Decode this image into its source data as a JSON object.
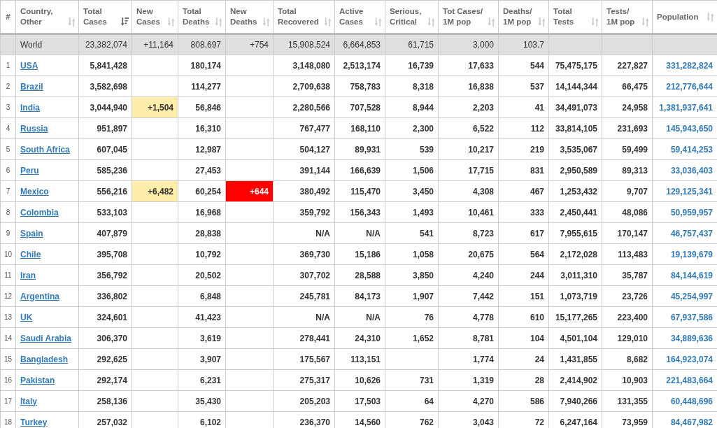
{
  "table": {
    "columns": [
      {
        "label": "#",
        "kind": "index"
      },
      {
        "label": "Country,\nOther",
        "kind": "sortable",
        "sorted": false
      },
      {
        "label": "Total\nCases",
        "kind": "sortable",
        "sorted": true
      },
      {
        "label": "New\nCases",
        "kind": "sortable",
        "sorted": false
      },
      {
        "label": "Total\nDeaths",
        "kind": "sortable",
        "sorted": false
      },
      {
        "label": "New\nDeaths",
        "kind": "sortable",
        "sorted": false
      },
      {
        "label": "Total\nRecovered",
        "kind": "sortable",
        "sorted": false
      },
      {
        "label": "Active\nCases",
        "kind": "sortable",
        "sorted": false
      },
      {
        "label": "Serious,\nCritical",
        "kind": "sortable",
        "sorted": false
      },
      {
        "label": "Tot Cases/\n1M pop",
        "kind": "sortable",
        "sorted": false
      },
      {
        "label": "Deaths/\n1M pop",
        "kind": "sortable",
        "sorted": false
      },
      {
        "label": "Total\nTests",
        "kind": "sortable",
        "sorted": false
      },
      {
        "label": "Tests/\n1M pop",
        "kind": "sortable",
        "sorted": false
      },
      {
        "label": "Population",
        "kind": "sortable",
        "sorted": false
      }
    ],
    "world_row": {
      "cells": [
        null,
        "World",
        "23,382,074",
        "+11,164",
        "808,697",
        "+754",
        "15,908,524",
        "6,664,853",
        "61,715",
        "3,000",
        "103.7",
        null,
        null,
        null
      ]
    },
    "rows": [
      {
        "cells": [
          "1",
          "USA",
          "5,841,428",
          null,
          "180,174",
          null,
          "3,148,080",
          "2,513,174",
          "16,739",
          "17,633",
          "544",
          "75,475,175",
          "227,827",
          "331,282,824"
        ]
      },
      {
        "cells": [
          "2",
          "Brazil",
          "3,582,698",
          null,
          "114,277",
          null,
          "2,709,638",
          "758,783",
          "8,318",
          "16,838",
          "537",
          "14,144,344",
          "66,475",
          "212,776,644"
        ]
      },
      {
        "cells": [
          "3",
          "India",
          "3,044,940",
          "+1,504",
          "56,846",
          null,
          "2,280,566",
          "707,528",
          "8,944",
          "2,203",
          "41",
          "34,491,073",
          "24,958",
          "1,381,937,641"
        ]
      },
      {
        "cells": [
          "4",
          "Russia",
          "951,897",
          null,
          "16,310",
          null,
          "767,477",
          "168,110",
          "2,300",
          "6,522",
          "112",
          "33,814,105",
          "231,693",
          "145,943,650"
        ]
      },
      {
        "cells": [
          "5",
          "South Africa",
          "607,045",
          null,
          "12,987",
          null,
          "504,127",
          "89,931",
          "539",
          "10,217",
          "219",
          "3,535,067",
          "59,499",
          "59,414,253"
        ]
      },
      {
        "cells": [
          "6",
          "Peru",
          "585,236",
          null,
          "27,453",
          null,
          "391,144",
          "166,639",
          "1,506",
          "17,715",
          "831",
          "2,950,589",
          "89,313",
          "33,036,403"
        ]
      },
      {
        "cells": [
          "7",
          "Mexico",
          "556,216",
          "+6,482",
          "60,254",
          "+644",
          "380,492",
          "115,470",
          "3,450",
          "4,308",
          "467",
          "1,253,432",
          "9,707",
          "129,125,341"
        ]
      },
      {
        "cells": [
          "8",
          "Colombia",
          "533,103",
          null,
          "16,968",
          null,
          "359,792",
          "156,343",
          "1,493",
          "10,461",
          "333",
          "2,450,441",
          "48,086",
          "50,959,957"
        ]
      },
      {
        "cells": [
          "9",
          "Spain",
          "407,879",
          null,
          "28,838",
          null,
          "N/A",
          "N/A",
          "541",
          "8,723",
          "617",
          "7,955,615",
          "170,147",
          "46,757,437"
        ]
      },
      {
        "cells": [
          "10",
          "Chile",
          "395,708",
          null,
          "10,792",
          null,
          "369,730",
          "15,186",
          "1,058",
          "20,675",
          "564",
          "2,172,028",
          "113,483",
          "19,139,679"
        ]
      },
      {
        "cells": [
          "11",
          "Iran",
          "356,792",
          null,
          "20,502",
          null,
          "307,702",
          "28,588",
          "3,850",
          "4,240",
          "244",
          "3,011,310",
          "35,787",
          "84,144,619"
        ]
      },
      {
        "cells": [
          "12",
          "Argentina",
          "336,802",
          null,
          "6,848",
          null,
          "245,781",
          "84,173",
          "1,907",
          "7,442",
          "151",
          "1,073,719",
          "23,726",
          "45,254,997"
        ]
      },
      {
        "cells": [
          "13",
          "UK",
          "324,601",
          null,
          "41,423",
          null,
          "N/A",
          "N/A",
          "76",
          "4,778",
          "610",
          "15,177,265",
          "223,400",
          "67,937,586"
        ]
      },
      {
        "cells": [
          "14",
          "Saudi Arabia",
          "306,370",
          null,
          "3,619",
          null,
          "278,441",
          "24,310",
          "1,652",
          "8,781",
          "104",
          "4,501,104",
          "129,010",
          "34,889,636"
        ]
      },
      {
        "cells": [
          "15",
          "Bangladesh",
          "292,625",
          null,
          "3,907",
          null,
          "175,567",
          "113,151",
          null,
          "1,774",
          "24",
          "1,431,855",
          "8,682",
          "164,923,074"
        ]
      },
      {
        "cells": [
          "16",
          "Pakistan",
          "292,174",
          null,
          "6,231",
          null,
          "275,317",
          "10,626",
          "731",
          "1,319",
          "28",
          "2,414,902",
          "10,903",
          "221,483,664"
        ]
      },
      {
        "cells": [
          "17",
          "Italy",
          "258,136",
          null,
          "35,430",
          null,
          "205,203",
          "17,503",
          "64",
          "4,270",
          "586",
          "7,940,266",
          "131,355",
          "60,448,696"
        ]
      },
      {
        "cells": [
          "18",
          "Turkey",
          "257,032",
          null,
          "6,102",
          null,
          "236,370",
          "14,560",
          "762",
          "3,043",
          "72",
          "6,247,164",
          "73,959",
          "84,467,982"
        ]
      }
    ]
  }
}
